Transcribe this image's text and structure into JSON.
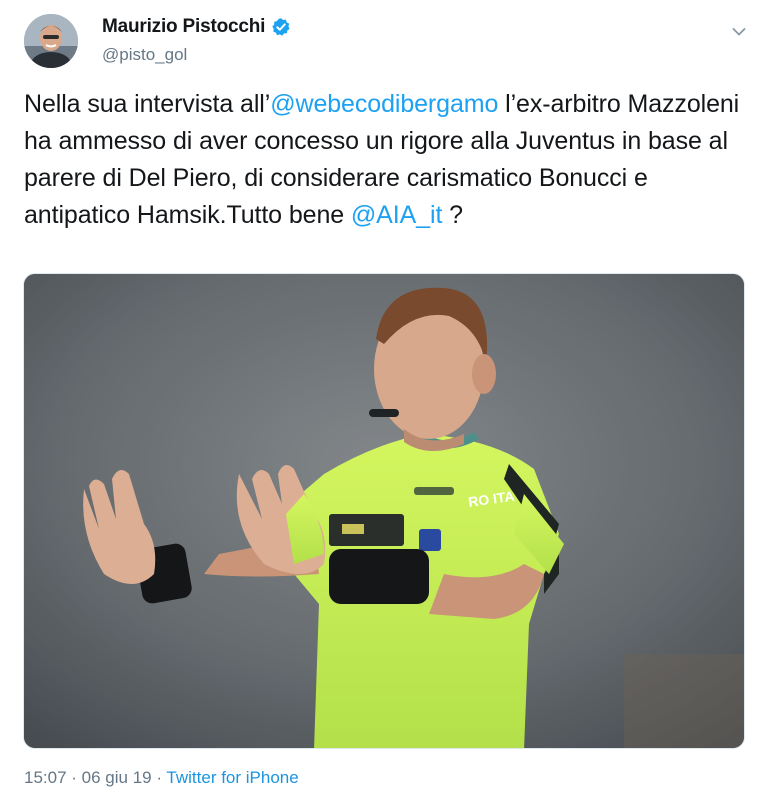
{
  "author": {
    "display_name": "Maurizio Pistocchi",
    "handle": "@pisto_gol",
    "verified": true,
    "verified_icon": "verified-badge-icon",
    "avatar_icon": "avatar-photo"
  },
  "tweet": {
    "text_1": "Nella sua intervista all’",
    "mention_1": "@webecodibergamo",
    "text_2": " l’ex-arbitro Mazzoleni ha ammesso di aver concesso un rigore alla Juventus in base al parere di Del Piero, di considerare carismatico Bonucci e antipatico Hamsik.Tutto bene ",
    "mention_2": "@AIA_it",
    "text_3": " ?"
  },
  "media": {
    "kind": "photo",
    "description_icon": "referee-photo",
    "shirt_text": "RO ITA"
  },
  "meta": {
    "time": "15:07",
    "separator_1": " · ",
    "date": "06 giu 19",
    "separator_2": " · ",
    "source": "Twitter for iPhone"
  },
  "colors": {
    "text": "#14171a",
    "secondary": "#657786",
    "link": "#1da1f2",
    "source_link": "#1b95e0",
    "verified": "#1da1f2",
    "kit_green": "#c8f05a"
  },
  "menu": {
    "caret_icon": "chevron-down-icon"
  }
}
